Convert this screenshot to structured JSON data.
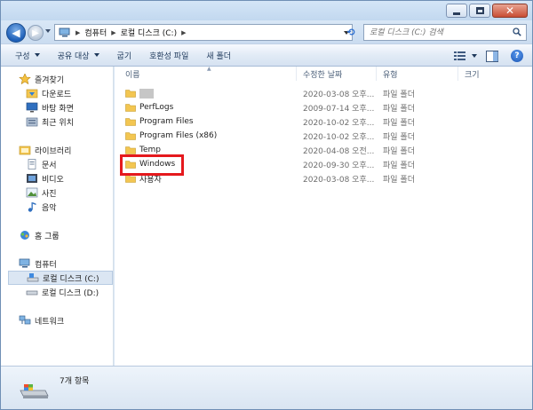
{
  "address": {
    "crumbs": [
      "컴퓨터",
      "로컬 디스크 (C:)"
    ],
    "search_placeholder": "로컬 디스크 (C:) 검색"
  },
  "toolbar": {
    "organize": "구성",
    "share_with": "공유 대상",
    "burn": "굽기",
    "compatibility_files": "호환성 파일",
    "new_folder": "새 폴더"
  },
  "sidebar": {
    "favorites": {
      "label": "즐겨찾기",
      "items": [
        {
          "label": "다운로드",
          "icon": "download-folder-icon"
        },
        {
          "label": "바탕 화면",
          "icon": "desktop-icon"
        },
        {
          "label": "최근 위치",
          "icon": "recent-places-icon"
        }
      ]
    },
    "libraries": {
      "label": "라이브러리",
      "items": [
        {
          "label": "문서",
          "icon": "documents-icon"
        },
        {
          "label": "비디오",
          "icon": "videos-icon"
        },
        {
          "label": "사진",
          "icon": "pictures-icon"
        },
        {
          "label": "음악",
          "icon": "music-icon"
        }
      ]
    },
    "homegroup": {
      "label": "홈 그룹",
      "icon": "homegroup-icon"
    },
    "computer": {
      "label": "컴퓨터",
      "items": [
        {
          "label": "로컬 디스크 (C:)",
          "icon": "local-disk-icon",
          "selected": true
        },
        {
          "label": "로컬 디스크 (D:)",
          "icon": "local-disk-icon",
          "selected": false
        }
      ]
    },
    "network": {
      "label": "네트워크",
      "icon": "network-icon"
    }
  },
  "columns": {
    "name": "이름",
    "date_modified": "수정한 날짜",
    "type": "유형",
    "size": "크기"
  },
  "files": [
    {
      "name": "",
      "redacted": true,
      "date": "2020-03-08 오후...",
      "type": "파일 폴더"
    },
    {
      "name": "PerfLogs",
      "date": "2009-07-14 오후...",
      "type": "파일 폴더"
    },
    {
      "name": "Program Files",
      "date": "2020-10-02 오후...",
      "type": "파일 폴더"
    },
    {
      "name": "Program Files (x86)",
      "date": "2020-10-02 오후...",
      "type": "파일 폴더"
    },
    {
      "name": "Temp",
      "date": "2020-04-08 오전...",
      "type": "파일 폴더"
    },
    {
      "name": "Windows",
      "date": "2020-09-30 오후...",
      "type": "파일 폴더",
      "highlighted": true
    },
    {
      "name": "사용자",
      "date": "2020-03-08 오후...",
      "type": "파일 폴더"
    }
  ],
  "status": {
    "item_count": "7개 항목"
  },
  "colors": {
    "highlight_box": "#e5191d",
    "folder": "#f3c651"
  }
}
